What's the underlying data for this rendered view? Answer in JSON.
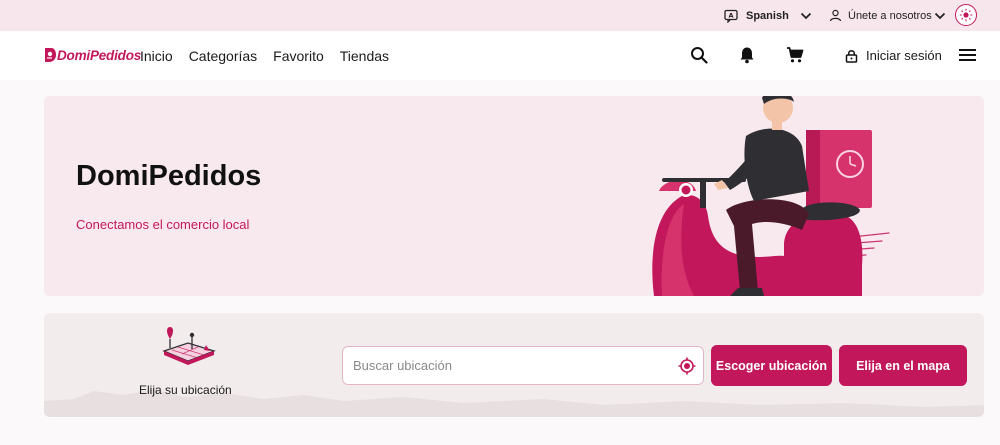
{
  "topbar": {
    "language": "Spanish",
    "join": "Únete a nosotros"
  },
  "nav": {
    "logo": "DomiPedidos",
    "links": [
      "Inicio",
      "Categorías",
      "Favorito",
      "Tiendas"
    ],
    "login": "Iniciar sesión"
  },
  "hero": {
    "title": "DomiPedidos",
    "subtitle": "Conectamos el comercio local"
  },
  "location": {
    "label": "Elija su ubicación",
    "search_placeholder": "Buscar ubicación",
    "choose_button": "Escoger ubicación",
    "map_button": "Elija en el mapa"
  },
  "colors": {
    "brand": "#c2185b",
    "topbar_bg": "#f7e6ec",
    "hero_bg": "#f8e9ee",
    "location_bg": "#f3eced"
  },
  "icons": {
    "language": "translate-icon",
    "user": "user-icon",
    "theme": "sun-icon",
    "search": "search-icon",
    "notifications": "bell-icon",
    "cart": "cart-icon",
    "login": "lock-icon",
    "menu": "hamburger-menu-icon",
    "gps": "crosshair-icon"
  }
}
